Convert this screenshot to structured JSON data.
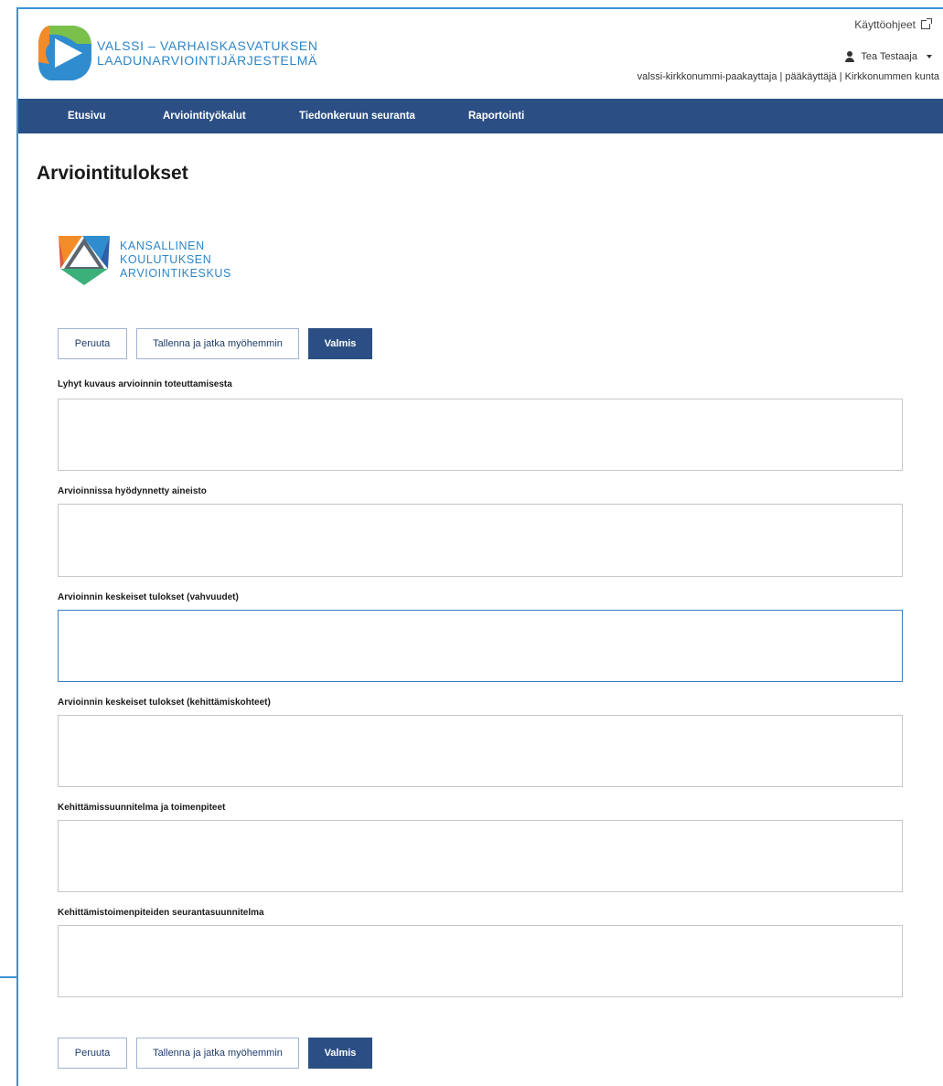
{
  "header": {
    "brand_line1": "VALSSI – VARHAISKASVATUKSEN",
    "brand_line2": "LAADUNARVIOINTIJÄRJESTELMÄ",
    "help_link": "Käyttöohjeet",
    "user_name": "Tea Testaaja",
    "role_line": "valssi-kirkkonummi-paakayttaja | pääkäyttäjä | Kirkkonummen kunta"
  },
  "nav": {
    "items": [
      "Etusivu",
      "Arviointityökalut",
      "Tiedonkeruun seuranta",
      "Raportointi"
    ]
  },
  "page": {
    "title": "Arviointitulokset"
  },
  "karvi": {
    "line1": "KANSALLINEN",
    "line2": "KOULUTUKSEN",
    "line3": "ARVIOINTIKESKUS"
  },
  "actions": {
    "cancel": "Peruuta",
    "save_later": "Tallenna ja jatka myöhemmin",
    "done": "Valmis"
  },
  "fields": [
    {
      "label": "Lyhyt kuvaus arvioinnin toteuttamisesta",
      "value": ""
    },
    {
      "label": "Arvioinnissa hyödynnetty aineisto",
      "value": ""
    },
    {
      "label": "Arvioinnin keskeiset tulokset (vahvuudet)",
      "value": ""
    },
    {
      "label": "Arvioinnin keskeiset tulokset (kehittämiskohteet)",
      "value": ""
    },
    {
      "label": "Kehittämissuunnitelma ja toimenpiteet",
      "value": ""
    },
    {
      "label": "Kehittämistoimenpiteiden seurantasuunnitelma",
      "value": ""
    }
  ],
  "colors": {
    "nav_bg": "#2b4f84",
    "brand_text": "#2d86c8",
    "frame": "#3b93d6",
    "primary_button": "#2b4f84"
  }
}
